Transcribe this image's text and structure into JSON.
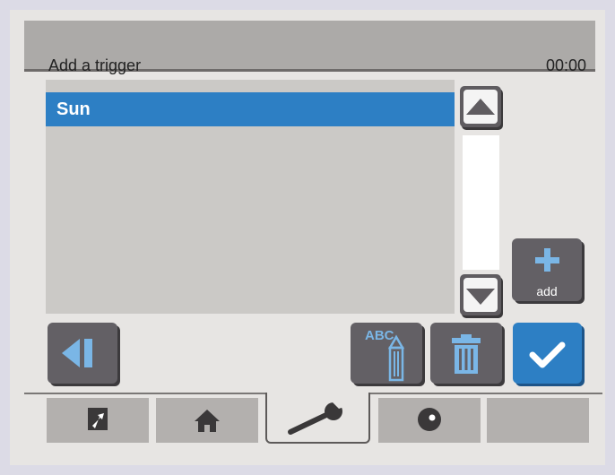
{
  "header": {
    "title": "Add a trigger",
    "time": "00:00"
  },
  "list": {
    "items": [
      {
        "label": "Sun",
        "selected": true
      }
    ]
  },
  "buttons": {
    "add_label": "add",
    "rename_label": "ABC"
  },
  "tabs": [
    {
      "name": "shortcut",
      "icon": "arrow-up-right-icon",
      "active": false
    },
    {
      "name": "home",
      "icon": "home-icon",
      "active": false
    },
    {
      "name": "settings",
      "icon": "wrench-icon",
      "active": true
    },
    {
      "name": "media",
      "icon": "disc-icon",
      "active": false
    },
    {
      "name": "empty",
      "icon": "",
      "active": false
    }
  ],
  "colors": {
    "accent": "#2d7fc4",
    "tile": "#636065",
    "header": "#acaaa8"
  }
}
